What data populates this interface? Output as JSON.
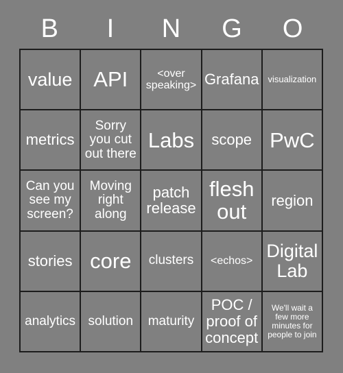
{
  "card": {
    "title": "BINGO",
    "background_color": "#808080",
    "text_color": "#ffffff",
    "border_color": "#1c1c1c",
    "header": {
      "letters": [
        "B",
        "I",
        "N",
        "G",
        "O"
      ]
    },
    "grid": {
      "columns": 5,
      "rows": 5,
      "cells": [
        {
          "text": "value",
          "size": "lg"
        },
        {
          "text": "API",
          "size": "xl"
        },
        {
          "text": "<over speaking>",
          "size": "xs"
        },
        {
          "text": "Grafana",
          "size": "md"
        },
        {
          "text": "visualization",
          "size": "xxs"
        },
        {
          "text": "metrics",
          "size": "md"
        },
        {
          "text": "Sorry you cut out there",
          "size": "sm"
        },
        {
          "text": "Labs",
          "size": "xl"
        },
        {
          "text": "scope",
          "size": "md"
        },
        {
          "text": "PwC",
          "size": "xl"
        },
        {
          "text": "Can you see my screen?",
          "size": "sm"
        },
        {
          "text": "Moving right along",
          "size": "sm"
        },
        {
          "text": "patch release",
          "size": "md"
        },
        {
          "text": "flesh out",
          "size": "xl"
        },
        {
          "text": "region",
          "size": "md"
        },
        {
          "text": "stories",
          "size": "md"
        },
        {
          "text": "core",
          "size": "xl"
        },
        {
          "text": "clusters",
          "size": "sm"
        },
        {
          "text": "<echos>",
          "size": "xs"
        },
        {
          "text": "Digital Lab",
          "size": "lg"
        },
        {
          "text": "analytics",
          "size": "sm"
        },
        {
          "text": "solution",
          "size": "sm"
        },
        {
          "text": "maturity",
          "size": "sm"
        },
        {
          "text": "POC / proof of concept",
          "size": "md"
        },
        {
          "text": "We'll wait a few more minutes for people to join",
          "size": "tiny"
        }
      ]
    }
  }
}
